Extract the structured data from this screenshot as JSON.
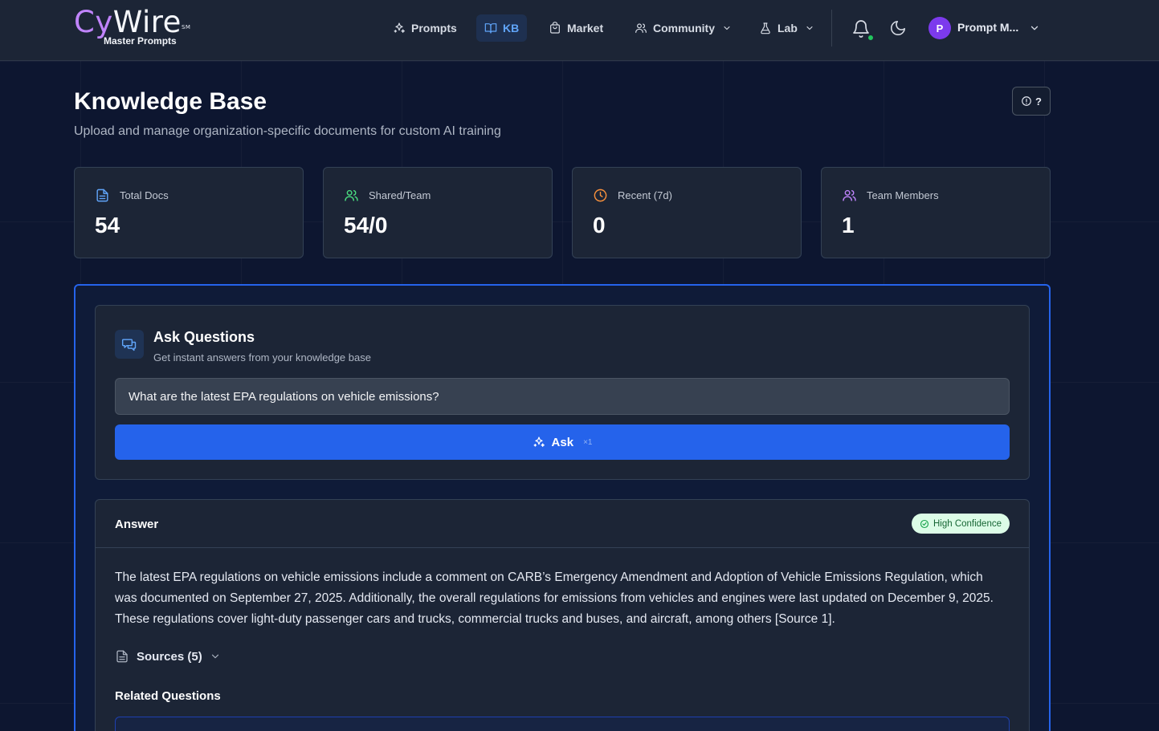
{
  "brand": {
    "logo_cy": "Cy",
    "logo_wire": "Wire",
    "logo_sm": "SM",
    "logo_sub": "Master Prompts"
  },
  "nav": {
    "items": [
      {
        "label": "Prompts",
        "icon": "sparkles-icon"
      },
      {
        "label": "KB",
        "icon": "book-open-icon",
        "active": true
      },
      {
        "label": "Market",
        "icon": "shopping-bag-icon"
      },
      {
        "label": "Community",
        "icon": "users-icon",
        "dropdown": true
      },
      {
        "label": "Lab",
        "icon": "flask-icon",
        "dropdown": true
      }
    ],
    "user": {
      "initial": "P",
      "name": "Prompt M..."
    }
  },
  "header": {
    "title": "Knowledge Base",
    "subtitle": "Upload and manage organization-specific documents for custom AI training",
    "help_label": "?"
  },
  "stats": [
    {
      "label": "Total Docs",
      "value": "54",
      "icon": "document-icon",
      "color": "#60a5fa"
    },
    {
      "label": "Shared/Team",
      "value": "54/0",
      "icon": "users-icon",
      "color": "#4ade80"
    },
    {
      "label": "Recent (7d)",
      "value": "0",
      "icon": "clock-icon",
      "color": "#fb923c"
    },
    {
      "label": "Team Members",
      "value": "1",
      "icon": "users-icon",
      "color": "#c084fc"
    }
  ],
  "ask": {
    "title": "Ask Questions",
    "subtitle": "Get instant answers from your knowledge base",
    "query": "What are the latest EPA regulations on vehicle emissions?",
    "button_label": "Ask",
    "button_kbd": "×1"
  },
  "answer": {
    "title": "Answer",
    "confidence": "High Confidence",
    "text": "The latest EPA regulations on vehicle emissions include a comment on CARB’s Emergency Amendment and Adoption of Vehicle Emissions Regulation, which was documented on September 27, 2025. Additionally, the overall regulations for emissions from vehicles and engines were last updated on December 9, 2025. These regulations cover light-duty passenger cars and trucks, commercial trucks and buses, and aircraft, among others [Source 1].",
    "sources_label": "Sources (5)",
    "related_title": "Related Questions"
  },
  "colors": {
    "accent": "#2563eb",
    "background": "#0d1630",
    "card": "#1c2536",
    "success": "#22c55e"
  }
}
